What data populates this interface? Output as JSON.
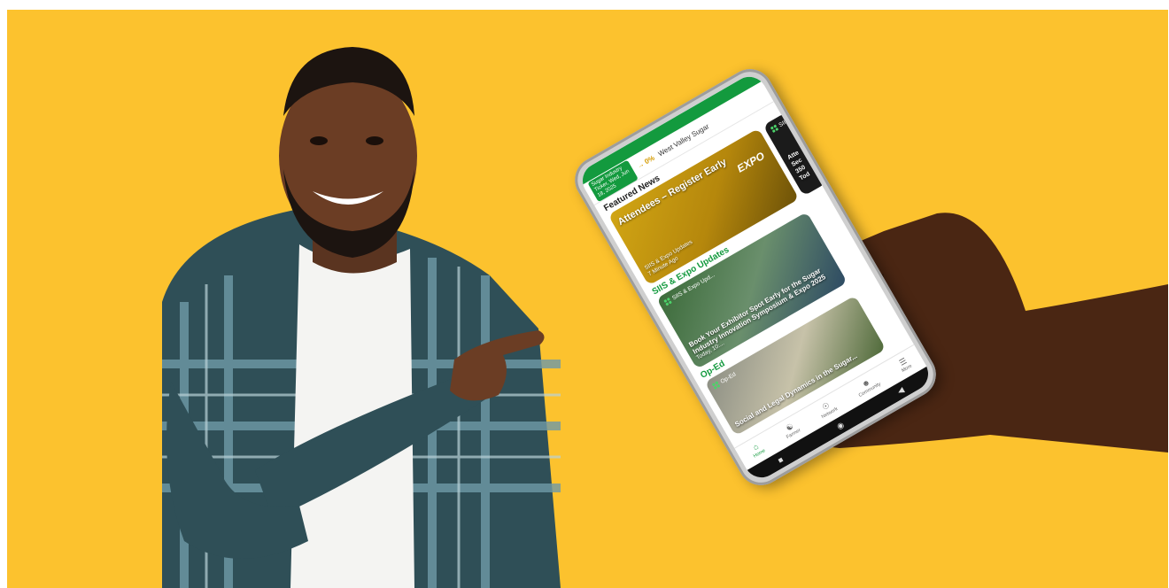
{
  "scene": {
    "background_color": "#fcc22e",
    "accent_green": "#139a3e"
  },
  "phone": {
    "status_bar": {
      "left": "",
      "right": ""
    },
    "app_bar": {
      "date_chip": "Sugar Industry Ticker, Wed, Jun 18, 2025",
      "price_change": "0%",
      "ticker_text": "West Valley Sugar"
    },
    "featured": {
      "section_title": "Featured News",
      "card": {
        "title": "Attendees – Register Early",
        "meta_category": "SIIS & Expo Updates",
        "meta_time": "7 Minute Ago",
        "badge": "EXPO"
      },
      "peek_card": {
        "tag": "SII",
        "text": "Atte Sec 350 Tod"
      }
    },
    "updates": {
      "section_title": "SIIS & Expo Updates",
      "card": {
        "tag": "SIIS & Expo Upd...",
        "caption": "Book Your Exhibitor Spot Early for the Sugar Industry Innovation Symposium & Expo 2025",
        "meta": "Today, 10:..."
      }
    },
    "oped": {
      "section_title": "Op-Ed",
      "card": {
        "tag": "Op-Ed",
        "caption": "Social and Legal Dynamics in the Sugar..."
      }
    },
    "bottom_nav": [
      {
        "label": "Home",
        "icon": "home-icon"
      },
      {
        "label": "Farmer",
        "icon": "farmer-icon"
      },
      {
        "label": "Network",
        "icon": "network-icon"
      },
      {
        "label": "Community",
        "icon": "community-icon"
      },
      {
        "label": "More",
        "icon": "menu-icon"
      }
    ]
  }
}
